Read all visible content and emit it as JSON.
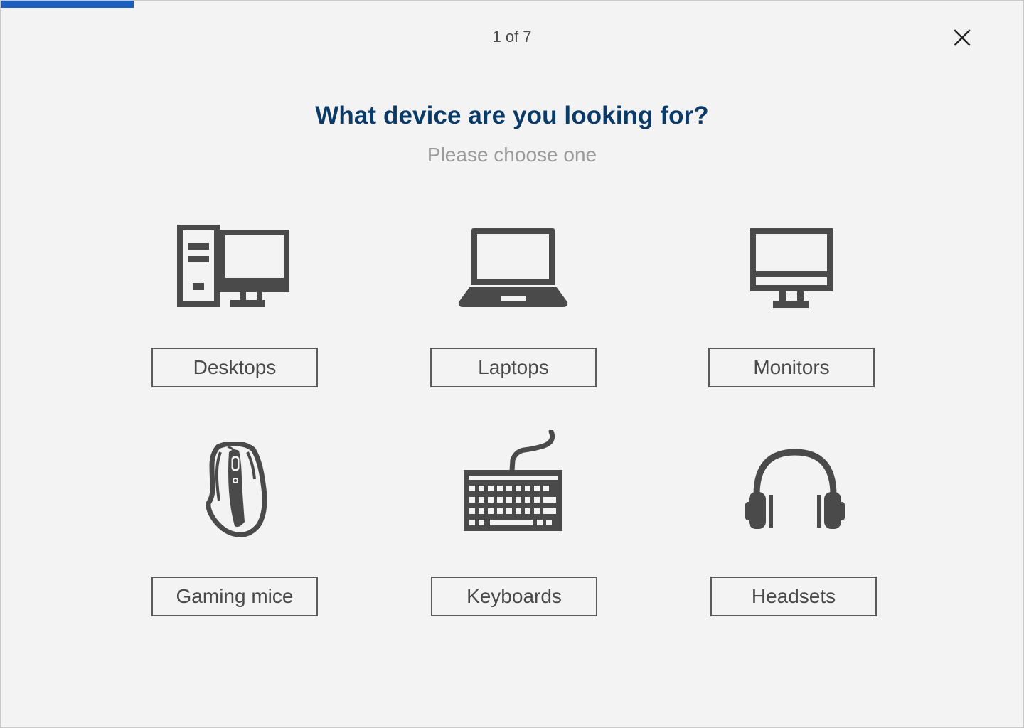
{
  "progress": {
    "fraction": 0.13,
    "color": "#1d5fbf"
  },
  "header": {
    "step_counter": "1 of 7",
    "close_icon": "close-icon"
  },
  "question": {
    "title": "What device are you looking for?",
    "subtitle": "Please choose one"
  },
  "colors": {
    "title": "#0b3a66",
    "icon": "#4a4a4a",
    "background": "#f3f3f3"
  },
  "options": [
    {
      "label": "Desktops",
      "icon": "desktop-icon"
    },
    {
      "label": "Laptops",
      "icon": "laptop-icon"
    },
    {
      "label": "Monitors",
      "icon": "monitor-icon"
    },
    {
      "label": "Gaming mice",
      "icon": "mouse-icon"
    },
    {
      "label": "Keyboards",
      "icon": "keyboard-icon"
    },
    {
      "label": "Headsets",
      "icon": "headset-icon"
    }
  ]
}
